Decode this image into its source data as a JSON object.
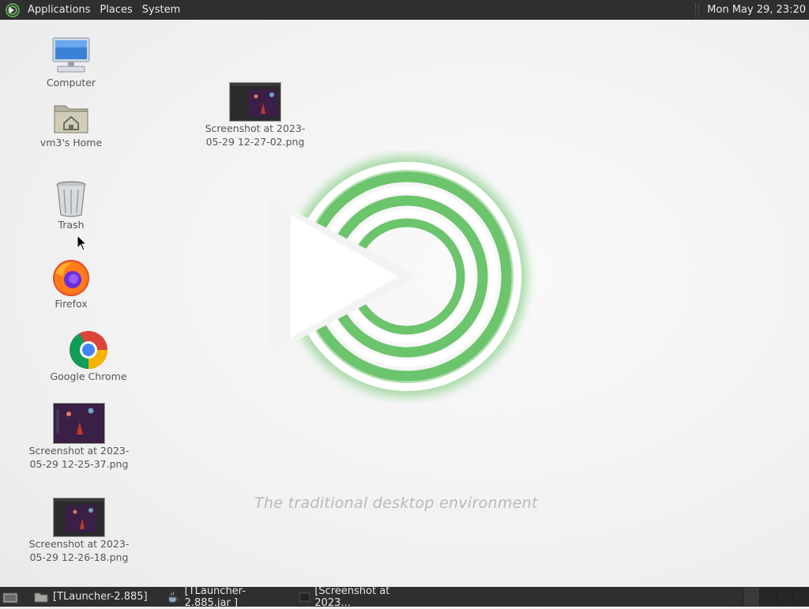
{
  "top_panel": {
    "menus": [
      "Applications",
      "Places",
      "System"
    ],
    "clock": "Mon May 29, 23:20"
  },
  "desktop": {
    "icons": [
      {
        "label": "Computer",
        "icon": "computer-icon"
      },
      {
        "label": "vm3's Home",
        "icon": "home-folder-icon"
      },
      {
        "label": "Trash",
        "icon": "trash-icon"
      },
      {
        "label": "Firefox",
        "icon": "firefox-icon"
      },
      {
        "label": "Google Chrome",
        "icon": "chrome-icon"
      },
      {
        "label": "Screenshot at 2023-\n05-29 12-25-37.png",
        "icon": "image-thumbnail-icon"
      },
      {
        "label": "Screenshot at 2023-\n05-29 12-26-18.png",
        "icon": "image-thumbnail-icon"
      },
      {
        "label": "Screenshot at 2023-\n05-29 12-27-02.png",
        "icon": "image-thumbnail-icon"
      }
    ]
  },
  "wallpaper": {
    "tagline": "The traditional desktop environment",
    "accent": "#6cc46c"
  },
  "bottom_panel": {
    "tasks": [
      {
        "label": "[TLauncher-2.885]",
        "icon": "folder-icon"
      },
      {
        "label": "[TLauncher-2.885.jar ]",
        "icon": "java-icon"
      },
      {
        "label": "[Screenshot at 2023...",
        "icon": "terminal-icon"
      }
    ]
  }
}
